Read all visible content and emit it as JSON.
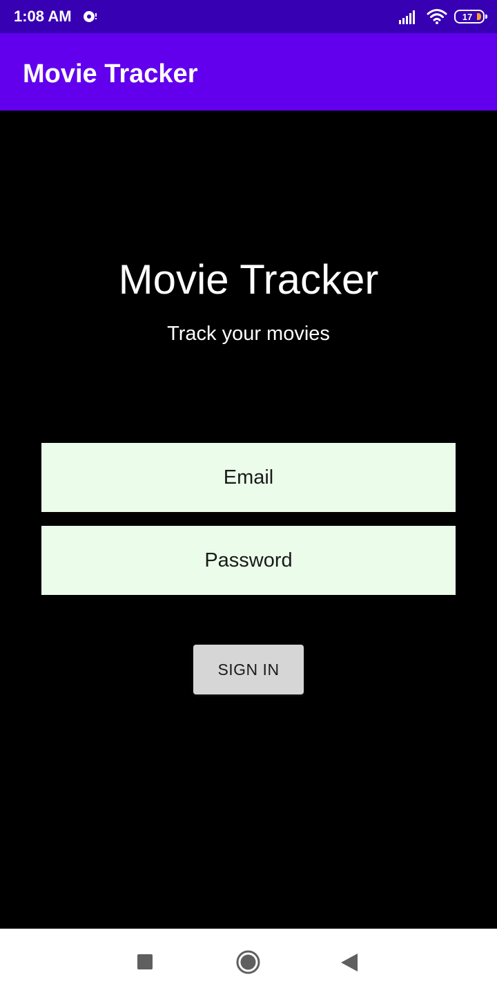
{
  "status_bar": {
    "time": "1:08 AM",
    "battery_level": "17",
    "icons": [
      "notification-icon",
      "signal-icon",
      "wifi-icon",
      "battery-icon"
    ]
  },
  "app_bar": {
    "title": "Movie Tracker",
    "color": "#6200ee"
  },
  "hero": {
    "title": "Movie Tracker",
    "subtitle": "Track your movies"
  },
  "form": {
    "email_placeholder": "Email",
    "password_placeholder": "Password",
    "email_value": "",
    "password_value": "",
    "signin_label": "SIGN IN",
    "field_color": "#ebfdea"
  },
  "nav_bar": {
    "icons": [
      "recents-icon",
      "home-icon",
      "back-icon"
    ]
  }
}
